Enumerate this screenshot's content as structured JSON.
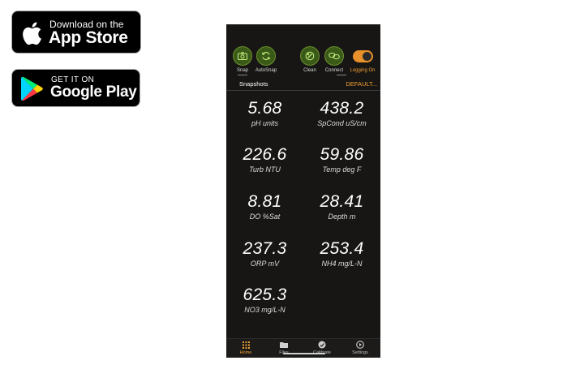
{
  "badges": {
    "apple": {
      "small": "Download on the",
      "big": "App Store",
      "icon": "apple-icon"
    },
    "google": {
      "small": "GET IT ON",
      "big": "Google Play",
      "icon": "google-play-icon"
    }
  },
  "toolbar": {
    "snap": "Snap",
    "autosnap": "AutoSnap",
    "clean": "Clean",
    "connect": "Connect",
    "logging": "Logging On",
    "logging_state": true
  },
  "snapshots": {
    "label": "Snapshots",
    "profile": "DEFAULT..."
  },
  "readings": [
    {
      "value": "5.68",
      "unit": "pH units"
    },
    {
      "value": "438.2",
      "unit": "SpCond uS/cm"
    },
    {
      "value": "226.6",
      "unit": "Turb NTU"
    },
    {
      "value": "59.86",
      "unit": "Temp deg F"
    },
    {
      "value": "8.81",
      "unit": "DO %Sat"
    },
    {
      "value": "28.41",
      "unit": "Depth m"
    },
    {
      "value": "237.3",
      "unit": "ORP mV"
    },
    {
      "value": "253.4",
      "unit": "NH4 mg/L-N"
    },
    {
      "value": "625.3",
      "unit": "NO3 mg/L-N"
    }
  ],
  "tabs": [
    {
      "label": "Home",
      "icon": "grid-icon",
      "active": true
    },
    {
      "label": "Files",
      "icon": "folder-icon"
    },
    {
      "label": "Calibrate",
      "icon": "gauge-icon"
    },
    {
      "label": "Settings",
      "icon": "play-circle-icon"
    }
  ],
  "colors": {
    "accent": "#f0a030",
    "screen_bg": "#171615",
    "tool_green": "#3a5a18"
  }
}
